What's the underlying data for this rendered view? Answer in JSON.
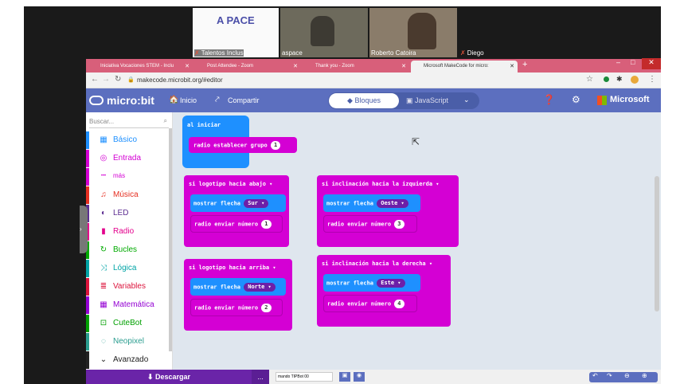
{
  "zoom": {
    "participants": [
      {
        "name": "Talentos Inclus"
      },
      {
        "name": "aspace"
      },
      {
        "name": "Roberto Catoira"
      },
      {
        "name": "Diego"
      }
    ],
    "logo_text": "A PACE"
  },
  "browser": {
    "tabs": [
      {
        "label": "Iniciativa Vocaciones STEM - Inclu"
      },
      {
        "label": "Post Attendee - Zoom"
      },
      {
        "label": "Thank you - Zoom"
      },
      {
        "label": "Microsoft MakeCode for micro:"
      }
    ],
    "url": "makecode.microbit.org/#editor"
  },
  "header": {
    "brand": "micro:bit",
    "home": "Inicio",
    "share": "Compartir",
    "blocks": "Bloques",
    "js": "JavaScript",
    "ms": "Microsoft"
  },
  "toolbox": {
    "search_placeholder": "Buscar...",
    "categories": [
      {
        "label": "Básico",
        "color": "#1e90ff",
        "icon": "grid-icon"
      },
      {
        "label": "Entrada",
        "color": "#d400d4",
        "icon": "target-icon"
      },
      {
        "label": "más",
        "color": "#d400d4",
        "icon": "more-icon"
      },
      {
        "label": "Música",
        "color": "#e63022",
        "icon": "headphones-icon"
      },
      {
        "label": "LED",
        "color": "#5c2d91",
        "icon": "toggle-icon"
      },
      {
        "label": "Radio",
        "color": "#e3008c",
        "icon": "signal-icon"
      },
      {
        "label": "Bucles",
        "color": "#00aa00",
        "icon": "loop-icon"
      },
      {
        "label": "Lógica",
        "color": "#00a4a6",
        "icon": "shuffle-icon"
      },
      {
        "label": "Variables",
        "color": "#dc143c",
        "icon": "list-icon"
      },
      {
        "label": "Matemática",
        "color": "#9400d3",
        "icon": "calc-icon"
      },
      {
        "label": "CuteBot",
        "color": "#00a000",
        "icon": "car-icon"
      },
      {
        "label": "Neopixel",
        "color": "#2a9d8f",
        "icon": "ring-icon"
      },
      {
        "label": "Avanzado",
        "color": "#222222",
        "icon": "chevron-down-icon"
      }
    ]
  },
  "blocks": {
    "on_start": {
      "hat": "al iniciar",
      "stmt": "radio establecer grupo",
      "val": "1"
    },
    "logo_down": {
      "hat": "si logotipo hacia abajo",
      "show": "mostrar flecha",
      "dir": "Sur",
      "send": "radio enviar número",
      "val": "1"
    },
    "logo_up": {
      "hat": "si logotipo hacia arriba",
      "show": "mostrar flecha",
      "dir": "Norte",
      "send": "radio enviar número",
      "val": "2"
    },
    "tilt_left": {
      "hat": "si inclinación hacia la izquierda",
      "show": "mostrar flecha",
      "dir": "Oeste",
      "send": "radio enviar número",
      "val": "3"
    },
    "tilt_right": {
      "hat": "si inclinación hacia la derecha",
      "show": "mostrar flecha",
      "dir": "Este",
      "send": "radio enviar número",
      "val": "4"
    }
  },
  "bottom": {
    "download": "Descargar",
    "more": "...",
    "filename": "mando TIPBot 00"
  }
}
